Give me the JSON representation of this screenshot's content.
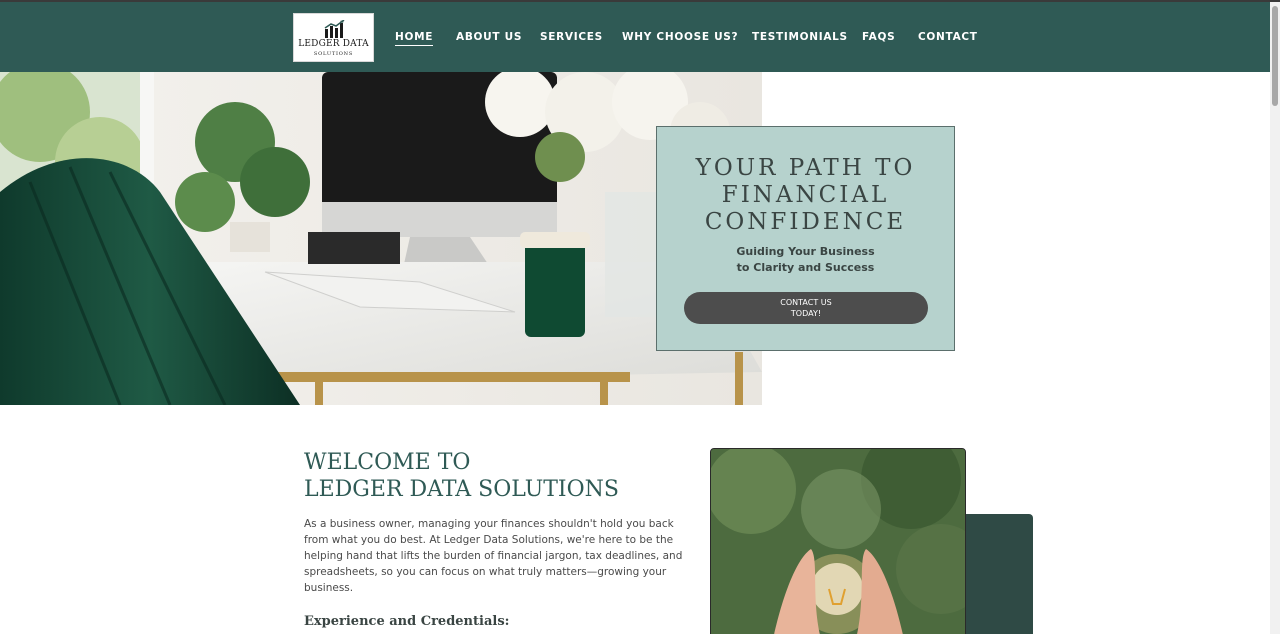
{
  "header": {
    "logo": {
      "title": "LEDGER DATA",
      "subtitle": "SOLUTIONS"
    },
    "nav": [
      {
        "label": "HOME",
        "active": true
      },
      {
        "label": "ABOUT US",
        "active": false
      },
      {
        "label": "SERVICES",
        "active": false
      },
      {
        "label": "WHY CHOOSE US?",
        "active": false
      },
      {
        "label": "TESTIMONIALS",
        "active": false
      },
      {
        "label": "FAQS",
        "active": false
      },
      {
        "label": "CONTACT",
        "active": false
      }
    ]
  },
  "hero": {
    "title_line1": "YOUR PATH TO",
    "title_line2": "FINANCIAL",
    "title_line3": "CONFIDENCE",
    "subtitle_line1": "Guiding Your Business",
    "subtitle_line2": "to Clarity and Success",
    "cta_line1": "CONTACT US",
    "cta_line2": "TODAY!"
  },
  "welcome": {
    "title_line1": "WELCOME TO",
    "title_line2": "LEDGER DATA SOLUTIONS",
    "body": "As a business owner, managing your finances shouldn't hold you back from what you do best. At Ledger Data Solutions, we're here to be the helping hand that lifts the burden of financial jargon, tax deadlines, and spreadsheets, so you can focus on what truly matters—growing your business.",
    "experience_heading": "Experience and Credentials:"
  },
  "colors": {
    "header_bg": "#2f5a55",
    "hero_card_bg": "#b6d2cd",
    "cta_bg": "#4d4d4d",
    "accent_dark_green": "#2f4a45"
  },
  "icons": {
    "logo_mark": "bar-chart-trend-icon"
  }
}
